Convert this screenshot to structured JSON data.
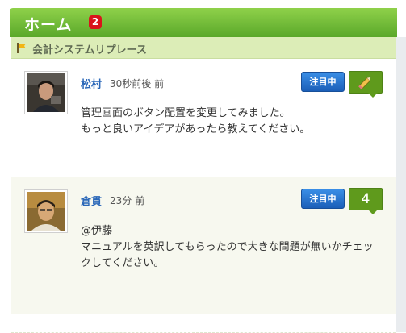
{
  "header": {
    "title": "ホーム",
    "badge_count": "2"
  },
  "group": {
    "name": "会計システムリプレース",
    "icon": "flag-icon"
  },
  "posts": [
    {
      "author": "松村",
      "time": "30秒前後 前",
      "watch_label": "注目中",
      "comment_icon": "pencil-icon",
      "body": "管理画面のボタン配置を変更してみました。\nもっと良いアイデアがあったら教えてください。"
    },
    {
      "author": "倉貫",
      "time": "23分 前",
      "watch_label": "注目中",
      "comment_count": "4",
      "body": "@伊藤\nマニュアルを英訳してもらったので大きな問題が無いかチェックしてください。"
    }
  ],
  "colors": {
    "header_green": "#6cb935",
    "group_bar": "#dcedb7",
    "watch_blue": "#2a78d4",
    "comment_green": "#5f9a1c",
    "badge_red": "#d9141b",
    "link_blue": "#2a67b8"
  }
}
